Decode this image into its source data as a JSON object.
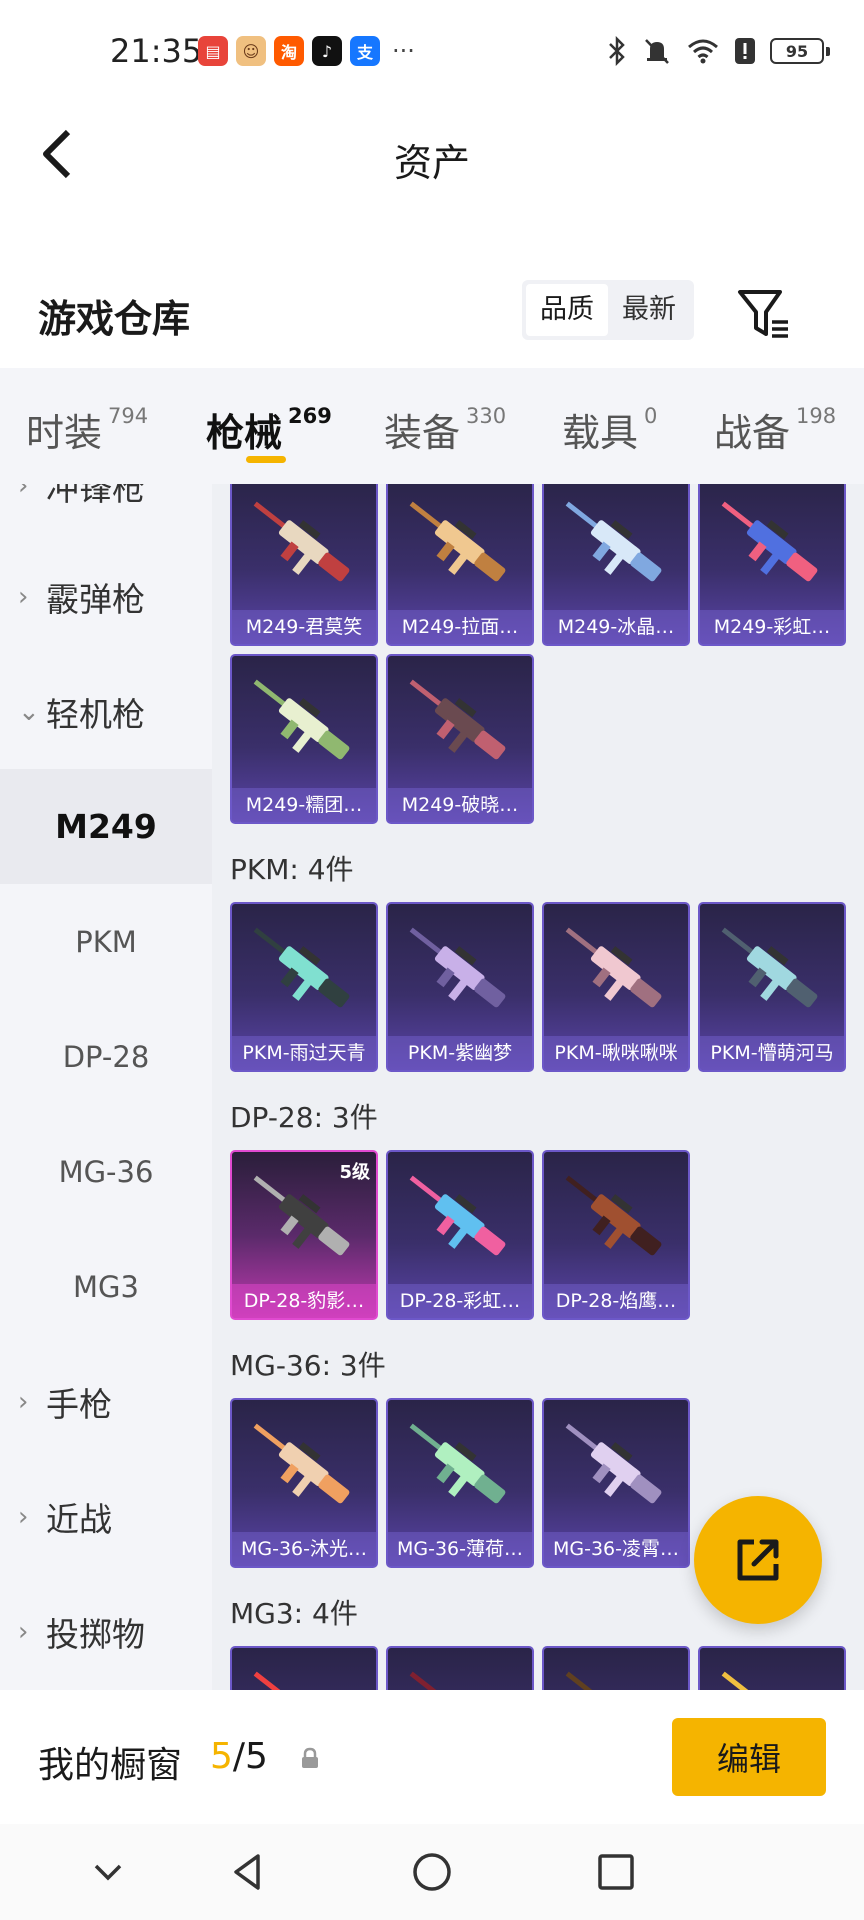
{
  "status": {
    "time": "21:35",
    "battery": "95",
    "apps": [
      {
        "icon": "huawei-mall-icon",
        "color": "#e8443a",
        "glyph": "▤"
      },
      {
        "icon": "avatar-app-icon",
        "color": "#f0c080",
        "glyph": "☺"
      },
      {
        "icon": "taobao-icon",
        "color": "#ff5a00",
        "glyph": "淘"
      },
      {
        "icon": "tiktok-icon",
        "color": "#111111",
        "glyph": "♪"
      },
      {
        "icon": "alipay-icon",
        "color": "#1677ff",
        "glyph": "支"
      }
    ],
    "more": "···"
  },
  "header": {
    "title": "资产"
  },
  "warehouse": {
    "title": "游戏仓库",
    "sort_options": [
      "品质",
      "最新"
    ]
  },
  "tabs": [
    {
      "label": "时装",
      "count": "794"
    },
    {
      "label": "枪械",
      "count": "269"
    },
    {
      "label": "装备",
      "count": "330"
    },
    {
      "label": "载具",
      "count": "0"
    },
    {
      "label": "战备",
      "count": "198"
    }
  ],
  "sidebar": {
    "partial_top": "冲锋枪",
    "categories": [
      "霰弹枪",
      "轻机枪",
      "手枪",
      "近战",
      "投掷物"
    ],
    "subitems": [
      "M249",
      "PKM",
      "DP-28",
      "MG-36",
      "MG3"
    ]
  },
  "groups": {
    "m249": {
      "cards": [
        "M249-君莫笑",
        "M249-拉面…",
        "M249-冰晶…",
        "M249-彩虹…",
        "M249-糯团…",
        "M249-破晓…"
      ]
    },
    "pkm": {
      "label": "PKM: 4件",
      "cards": [
        "PKM-雨过天青",
        "PKM-紫幽梦",
        "PKM-啾咪啾咪",
        "PKM-懵萌河马"
      ]
    },
    "dp28": {
      "label": "DP-28: 3件",
      "level": "5级",
      "cards": [
        "DP-28-豹影…",
        "DP-28-彩虹…",
        "DP-28-焰鹰…"
      ]
    },
    "mg36": {
      "label": "MG-36: 3件",
      "cards": [
        "MG-36-沐光…",
        "MG-36-薄荷…",
        "MG-36-凌霄…"
      ]
    },
    "mg3": {
      "label": "MG3: 4件"
    }
  },
  "showcase": {
    "label": "我的橱窗",
    "current": "5",
    "separator": "/5",
    "edit": "编辑"
  },
  "colors": {
    "accent": "#f5b400",
    "card_border": "#6c58c8",
    "legendary": "#e04ad0"
  }
}
